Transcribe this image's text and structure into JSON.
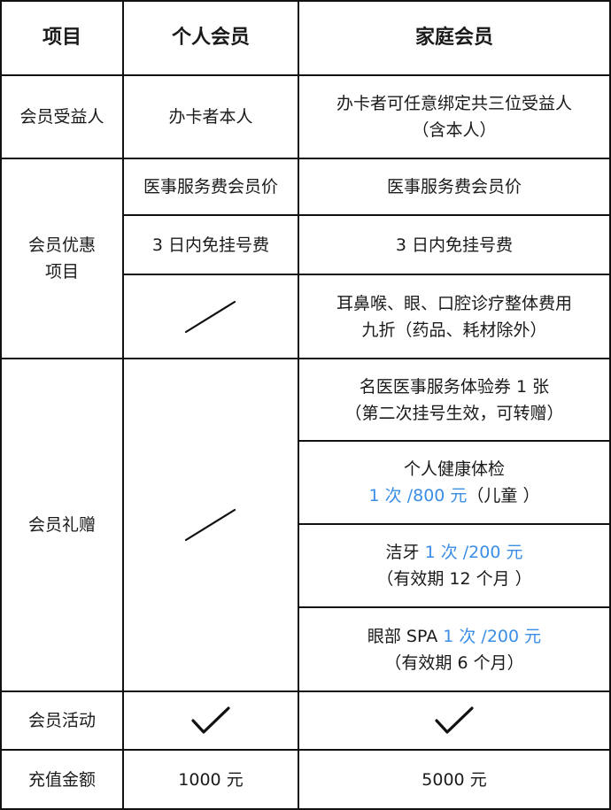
{
  "header": {
    "item": "项目",
    "personal": "个人会员",
    "family": "家庭会员"
  },
  "beneficiary": {
    "label": "会员受益人",
    "personal": "办卡者本人",
    "family_line1": "办卡者可任意绑定共三位受益人",
    "family_line2": "（含本人）"
  },
  "benefits": {
    "label_line1": "会员优惠",
    "label_line2": "项目",
    "row1_personal": "医事服务费会员价",
    "row1_family": "医事服务费会员价",
    "row2_personal": "3 日内免挂号费",
    "row2_family": "3 日内免挂号费",
    "row3_personal_icon": "slash-icon",
    "row3_family_line1": "耳鼻喉、眼、口腔诊疗整体费用",
    "row3_family_line2": "九折（药品、耗材除外）"
  },
  "gifts": {
    "label": "会员礼赠",
    "personal_icon": "slash-icon",
    "g1_line1": "名医医事服务体验券 1 张",
    "g1_line2": "（第二次挂号生效，可转赠）",
    "g2_line1": "个人健康体检",
    "g2_hl": "1 次 /800 元",
    "g2_tail": "（儿童 ）",
    "g3_prefix": "洁牙 ",
    "g3_hl": "1 次 /200 元",
    "g3_line2": "（有效期 12 个月 ）",
    "g4_prefix": "眼部 SPA ",
    "g4_hl": "1 次 /200 元",
    "g4_line2": "（有效期 6 个月）"
  },
  "activity": {
    "label": "会员活动",
    "personal_icon": "check-icon",
    "family_icon": "check-icon"
  },
  "recharge": {
    "label": "充值金额",
    "personal": "1000 元",
    "family": "5000 元"
  },
  "colors": {
    "highlight": "#3a8ee6",
    "border": "#111111"
  }
}
